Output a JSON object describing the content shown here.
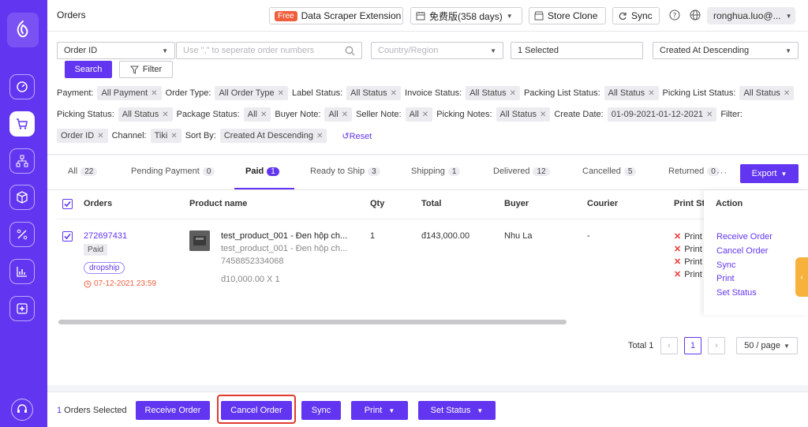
{
  "app": {
    "title": "Orders"
  },
  "topbar": {
    "free_badge": "Free",
    "scraper_label": "Data Scraper Extension",
    "plan_label": "免费版(358 days)",
    "store_clone_label": "Store Clone",
    "sync_label": "Sync",
    "user_label": "ronghua.luo@..."
  },
  "filters": {
    "order_id_select": "Order ID",
    "search_placeholder": "Use \",\" to seperate order numbers",
    "country_placeholder": "Country/Region",
    "selected_value": "1 Selected",
    "sort_value": "Created At Descending",
    "search_button": "Search",
    "filter_button": "Filter",
    "row1": [
      {
        "label": "Payment:",
        "value": "All Payment"
      },
      {
        "label": "Order Type:",
        "value": "All Order Type"
      },
      {
        "label": "Label Status:",
        "value": "All Status"
      },
      {
        "label": "Invoice Status:",
        "value": "All Status"
      },
      {
        "label": "Packing List Status:",
        "value": "All Status"
      },
      {
        "label": "Picking List Status:",
        "value": "All Status"
      }
    ],
    "row2": [
      {
        "label": "Picking Status:",
        "value": "All Status"
      },
      {
        "label": "Package Status:",
        "value": "All"
      },
      {
        "label": "Buyer Note:",
        "value": "All"
      },
      {
        "label": "Seller Note:",
        "value": "All"
      },
      {
        "label": "Picking Notes:",
        "value": "All Status"
      },
      {
        "label": "Create Date:",
        "value": "01-09-2021-01-12-2021"
      }
    ],
    "row2_trailing_label": "Filter:",
    "row3": [
      {
        "label": "",
        "value": "Order ID"
      },
      {
        "label": "Channel:",
        "value": "Tiki"
      },
      {
        "label": "Sort By:",
        "value": "Created At Descending"
      }
    ],
    "reset_label": "Reset"
  },
  "tabs": [
    {
      "label": "All",
      "count": "22"
    },
    {
      "label": "Pending Payment",
      "count": "0"
    },
    {
      "label": "Paid",
      "count": "1"
    },
    {
      "label": "Ready to Ship",
      "count": "3"
    },
    {
      "label": "Shipping",
      "count": "1"
    },
    {
      "label": "Delivered",
      "count": "12"
    },
    {
      "label": "Cancelled",
      "count": "5"
    },
    {
      "label": "Returned",
      "count": "0"
    }
  ],
  "more_label": "···",
  "export_label": "Export",
  "table": {
    "headers": {
      "orders": "Orders",
      "product": "Product name",
      "qty": "Qty",
      "total": "Total",
      "buyer": "Buyer",
      "courier": "Courier",
      "print_status": "Print Sta",
      "action": "Action"
    },
    "row": {
      "order_id": "272697431",
      "status": "Paid",
      "tag": "dropship",
      "date": "07-12-2021 23:59",
      "product_title": "test_product_001 - Đen hộp ch...",
      "product_variant": "test_product_001 - Đen hộp ch...",
      "sku": "7458852334068",
      "unit_price": "đ10,000.00 X 1",
      "qty": "1",
      "total": "đ143,000.00",
      "buyer": "Nhu La",
      "courier": "-",
      "print_items": [
        "Print",
        "Print",
        "Print",
        "Print"
      ]
    },
    "actions": [
      "Receive Order",
      "Cancel Order",
      "Sync",
      "Print",
      "Set Status"
    ]
  },
  "pagination": {
    "total_label": "Total 1",
    "current_page": "1",
    "page_size": "50 / page"
  },
  "bottom": {
    "selected_count": "1",
    "selected_text": " Orders Selected",
    "receive_button": "Receive Order",
    "cancel_button": "Cancel Order",
    "sync_button": "Sync",
    "print_button": "Print",
    "set_status_button": "Set Status"
  },
  "colors": {
    "accent": "#6236f0",
    "highlight": "#e03a2f",
    "toggle": "#f6b23d"
  }
}
